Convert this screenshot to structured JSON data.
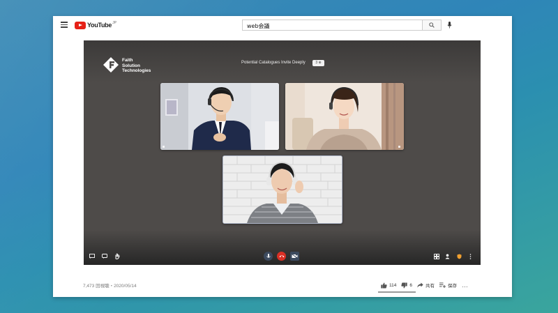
{
  "search": {
    "query": "web会議"
  },
  "header": {
    "logo_text": "YouTube",
    "logo_suffix": "JP"
  },
  "video": {
    "brand_line1": "Faith",
    "brand_line2": "Solution",
    "brand_line3": "Technologies",
    "meeting_title": "Potential Catalogues Invite Deeply",
    "meeting_badge": "3 ⊕"
  },
  "meta": {
    "views_date": "7,473 回視聴・2020/05/14"
  },
  "actions": {
    "like_count": "114",
    "dislike_count": "6",
    "share_label": "共有",
    "save_label": "保存",
    "more_label": "…"
  },
  "colors": {
    "brand_red": "#e62117",
    "end_call": "#d93025",
    "accent_orange": "#f0a030"
  }
}
